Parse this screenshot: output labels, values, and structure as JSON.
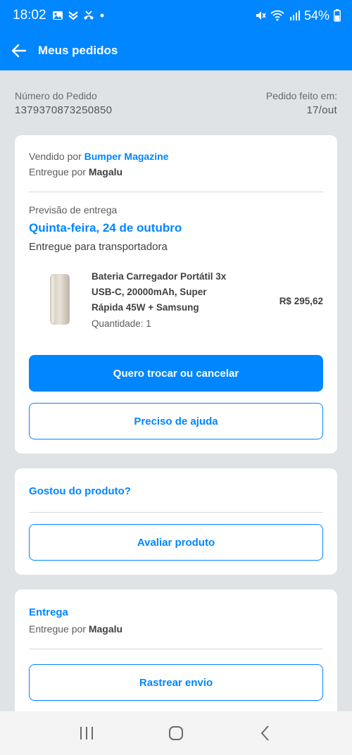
{
  "status_bar": {
    "time": "18:02",
    "battery": "54%",
    "left_icons": [
      "gallery-icon",
      "app-icon",
      "missed-call-icon",
      "dot-icon"
    ],
    "right_icons": [
      "mute-icon",
      "wifi-icon",
      "signal-icon",
      "battery-icon"
    ]
  },
  "app_bar": {
    "title": "Meus pedidos"
  },
  "order": {
    "number_label": "Número do Pedido",
    "number_value": "1379370873250850",
    "date_label": "Pedido feito em:",
    "date_value": "17/out"
  },
  "shipment": {
    "sold_by_prefix": "Vendido por ",
    "sold_by": "Bumper Magazine",
    "delivered_by_prefix": "Entregue por ",
    "delivered_by": "Magalu",
    "forecast_label": "Previsão de entrega",
    "forecast_date": "Quinta-feira, 24 de outubro",
    "status": "Entregue para transportadora",
    "product": {
      "name_line1": "Bateria Carregador Portátil 3x",
      "name_line2": "USB-C, 20000mAh, Super",
      "name_line3": "Rápida 45W + Samsung",
      "quantity": "Quantidade: 1",
      "price": "R$ 295,62"
    },
    "exchange_button": "Quero trocar ou cancelar",
    "help_button": "Preciso de ajuda"
  },
  "review": {
    "title": "Gostou do produto?",
    "button": "Avaliar produto"
  },
  "delivery": {
    "title": "Entrega",
    "delivered_by_prefix": "Entregue por ",
    "delivered_by": "Magalu",
    "track_button": "Rastrear envio"
  },
  "colors": {
    "brand_blue": "#0086ff",
    "background": "#dfe3e6"
  }
}
